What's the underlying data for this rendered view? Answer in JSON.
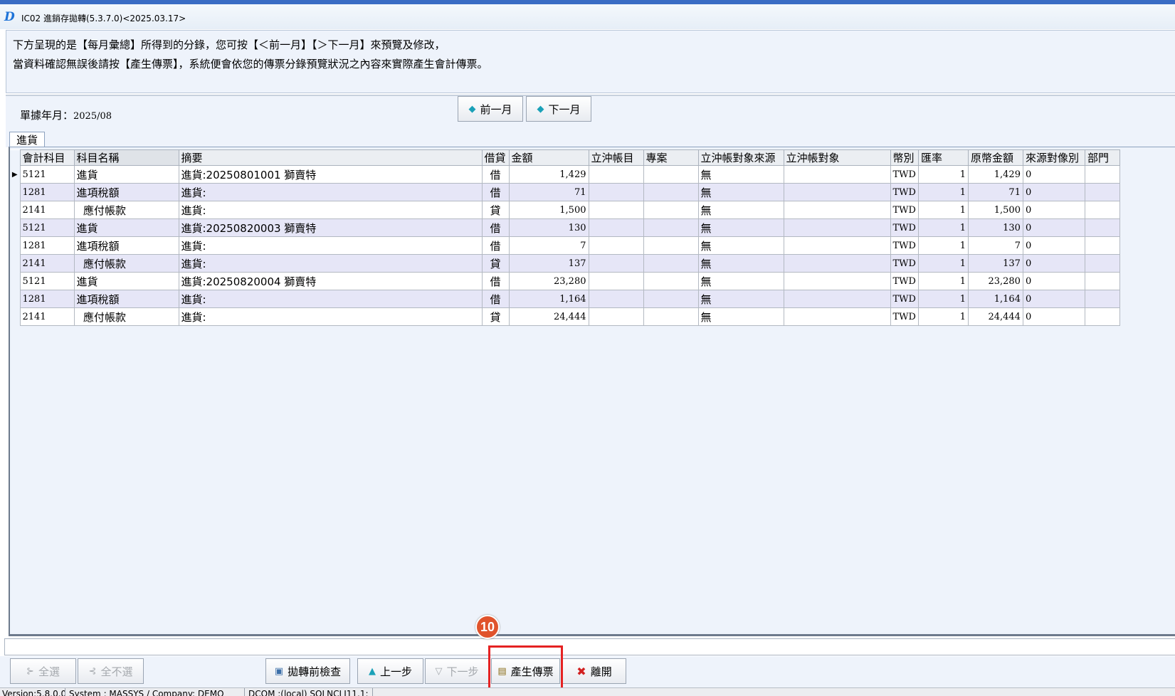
{
  "window": {
    "title": "IC02 進銷存拋轉(5.3.7.0)<2025.03.17>",
    "logo_letter": "D"
  },
  "message": {
    "line1": "下方呈現的是【每月彙總】所得到的分錄，您可按【＜前一月】【＞下一月】來預覽及修改，",
    "line2": "當資料確認無誤後請按【產生傳票】，系統便會依您的傳票分錄預覽狀況之內容來實際產生會計傳票。"
  },
  "period": {
    "label": "單據年月：",
    "value": "2025/08",
    "prev_label": "前一月",
    "next_label": "下一月"
  },
  "tabs": [
    {
      "label": "進貨"
    }
  ],
  "grid": {
    "columns": [
      "會計科目",
      "科目名稱",
      "摘要",
      "借貸",
      "金額",
      "立沖帳目",
      "專案",
      "立沖帳對象來源",
      "立沖帳對象",
      "幣別",
      "匯率",
      "原幣金額",
      "來源對像別",
      "部門"
    ],
    "current_row_marker": "▶",
    "rows": [
      {
        "code": "5121",
        "name": "進貨",
        "summary": "進貨:20250801001 獅賣特",
        "dc": "借",
        "amount": "1,429",
        "offset": "",
        "project": "",
        "obj_source": "無",
        "obj": "",
        "currency": "TWD",
        "rate": "1",
        "orig_amount": "1,429",
        "src_type": "0",
        "dept": ""
      },
      {
        "code": "1281",
        "name": "進項稅額",
        "summary": "進貨:",
        "dc": "借",
        "amount": "71",
        "offset": "",
        "project": "",
        "obj_source": "無",
        "obj": "",
        "currency": "TWD",
        "rate": "1",
        "orig_amount": "71",
        "src_type": "0",
        "dept": ""
      },
      {
        "code": "2141",
        "name": "  應付帳款",
        "summary": "進貨:",
        "dc": "貸",
        "amount": "1,500",
        "offset": "",
        "project": "",
        "obj_source": "無",
        "obj": "",
        "currency": "TWD",
        "rate": "1",
        "orig_amount": "1,500",
        "src_type": "0",
        "dept": ""
      },
      {
        "code": "5121",
        "name": "進貨",
        "summary": "進貨:20250820003 獅賣特",
        "dc": "借",
        "amount": "130",
        "offset": "",
        "project": "",
        "obj_source": "無",
        "obj": "",
        "currency": "TWD",
        "rate": "1",
        "orig_amount": "130",
        "src_type": "0",
        "dept": ""
      },
      {
        "code": "1281",
        "name": "進項稅額",
        "summary": "進貨:",
        "dc": "借",
        "amount": "7",
        "offset": "",
        "project": "",
        "obj_source": "無",
        "obj": "",
        "currency": "TWD",
        "rate": "1",
        "orig_amount": "7",
        "src_type": "0",
        "dept": ""
      },
      {
        "code": "2141",
        "name": "  應付帳款",
        "summary": "進貨:",
        "dc": "貸",
        "amount": "137",
        "offset": "",
        "project": "",
        "obj_source": "無",
        "obj": "",
        "currency": "TWD",
        "rate": "1",
        "orig_amount": "137",
        "src_type": "0",
        "dept": ""
      },
      {
        "code": "5121",
        "name": "進貨",
        "summary": "進貨:20250820004 獅賣特",
        "dc": "借",
        "amount": "23,280",
        "offset": "",
        "project": "",
        "obj_source": "無",
        "obj": "",
        "currency": "TWD",
        "rate": "1",
        "orig_amount": "23,280",
        "src_type": "0",
        "dept": ""
      },
      {
        "code": "1281",
        "name": "進項稅額",
        "summary": "進貨:",
        "dc": "借",
        "amount": "1,164",
        "offset": "",
        "project": "",
        "obj_source": "無",
        "obj": "",
        "currency": "TWD",
        "rate": "1",
        "orig_amount": "1,164",
        "src_type": "0",
        "dept": ""
      },
      {
        "code": "2141",
        "name": "  應付帳款",
        "summary": "進貨:",
        "dc": "貸",
        "amount": "24,444",
        "offset": "",
        "project": "",
        "obj_source": "無",
        "obj": "",
        "currency": "TWD",
        "rate": "1",
        "orig_amount": "24,444",
        "src_type": "0",
        "dept": ""
      }
    ]
  },
  "toolbar": {
    "select_all": "全選",
    "deselect_all": "全不選",
    "precheck": "拋轉前檢查",
    "prev_step": "上一步",
    "next_step": "下一步",
    "generate_voucher": "產生傳票",
    "exit": "離開"
  },
  "annotation": {
    "step_number": "10",
    "color": "#e0532c"
  },
  "statusbar": {
    "version": "Version:5.8.0.0",
    "system": "System : MASSYS   / Company: DEMO",
    "db": "DCOM   :(local) SQLNCLI11.1:"
  },
  "colors": {
    "panel_bg": "#eef3fb",
    "alt_row": "#e6e6f7",
    "highlight_border": "#e52222",
    "exit_icon": "#d22020"
  }
}
